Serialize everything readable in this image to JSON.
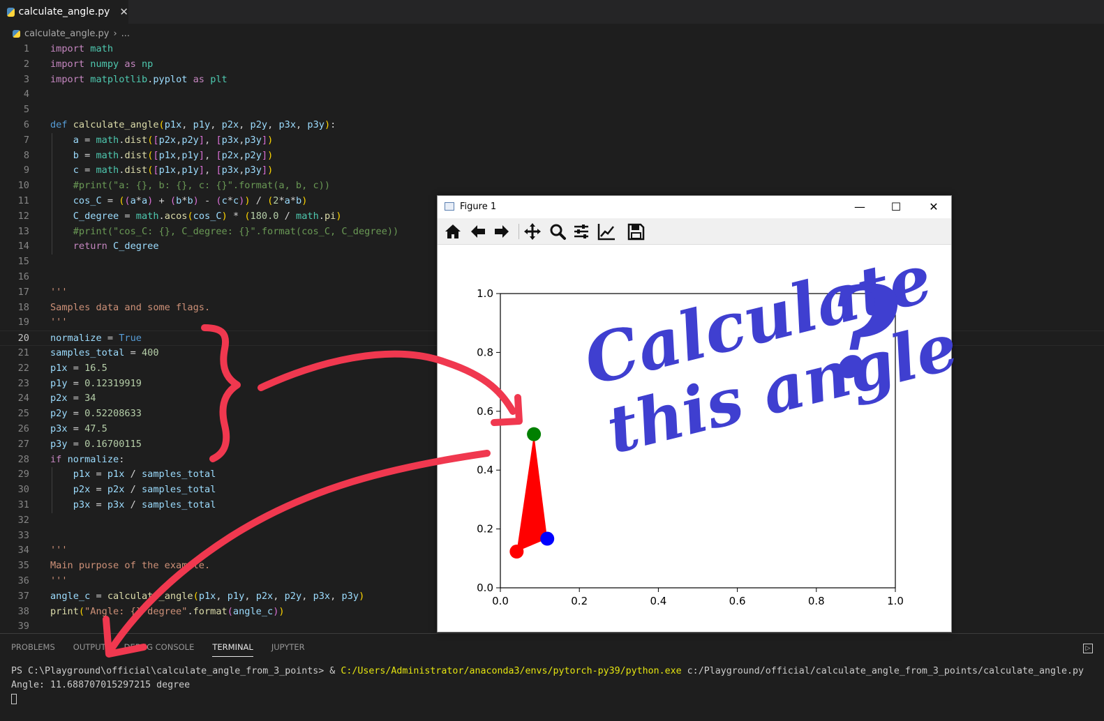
{
  "tab": {
    "filename": "calculate_angle.py",
    "close_glyph": "✕"
  },
  "breadcrumb": {
    "file": "calculate_angle.py",
    "rest": "..."
  },
  "editor": {
    "current_line": 20,
    "lines": [
      "import math",
      "import numpy as np",
      "import matplotlib.pyplot as plt",
      "",
      "",
      "def calculate_angle(p1x, p1y, p2x, p2y, p3x, p3y):",
      "    a = math.dist([p2x,p2y], [p3x,p3y])",
      "    b = math.dist([p1x,p1y], [p2x,p2y])",
      "    c = math.dist([p1x,p1y], [p3x,p3y])",
      "    #print(\"a: {}, b: {}, c: {}\".format(a, b, c))",
      "    cos_C = ((a*a) + (b*b) - (c*c)) / (2*a*b)",
      "    C_degree = math.acos(cos_C) * (180.0 / math.pi)",
      "    #print(\"cos_C: {}, C_degree: {}\".format(cos_C, C_degree))",
      "    return C_degree",
      "",
      "",
      "'''",
      "Samples data and some flags.",
      "'''",
      "normalize = True",
      "samples_total = 400",
      "p1x = 16.5",
      "p1y = 0.12319919",
      "p2x = 34",
      "p2y = 0.52208633",
      "p3x = 47.5",
      "p3y = 0.16700115",
      "if normalize:",
      "    p1x = p1x / samples_total",
      "    p2x = p2x / samples_total",
      "    p3x = p3x / samples_total",
      "",
      "",
      "'''",
      "Main purpose of the example.",
      "'''",
      "angle_c = calculate_angle(p1x, p1y, p2x, p2y, p3x, p3y)",
      "print(\"Angle: {} degree\".format(angle_c))",
      ""
    ]
  },
  "panel": {
    "tabs": [
      "PROBLEMS",
      "OUTPUT",
      "DEBUG CONSOLE",
      "TERMINAL",
      "JUPYTER"
    ],
    "active_tab": "TERMINAL",
    "toggle_glyph": "▷",
    "terminal": {
      "prompt": "PS C:\\Playground\\official\\calculate_angle_from_3_points> & ",
      "exe": "C:/Users/Administrator/anaconda3/envs/pytorch-py39/python.exe",
      "script": " c:/Playground/official/calculate_angle_from_3_points/calculate_angle.py",
      "output": "Angle: 11.688707015297215 degree"
    }
  },
  "figure": {
    "title": "Figure 1",
    "window_buttons": {
      "minimize": "—",
      "maximize": "☐",
      "close": "✕"
    },
    "toolbar": [
      "home-icon",
      "back-icon",
      "forward-icon",
      "pan-icon",
      "zoom-icon",
      "configure-subplots-icon",
      "edit-axis-icon",
      "save-icon"
    ]
  },
  "chart_data": {
    "type": "scatter",
    "xlim": [
      0.0,
      1.0
    ],
    "ylim": [
      0.0,
      1.0
    ],
    "xticks": [
      "0.0",
      "0.2",
      "0.4",
      "0.6",
      "0.8",
      "1.0"
    ],
    "yticks": [
      "0.0",
      "0.2",
      "0.4",
      "0.6",
      "0.8",
      "1.0"
    ],
    "triangle": {
      "x": [
        0.04125,
        0.085,
        0.11875
      ],
      "y": [
        0.12319919,
        0.52208633,
        0.16700115
      ],
      "fill": "#ff0000"
    },
    "points": [
      {
        "x": 0.04125,
        "y": 0.12319919,
        "color": "#ff0000"
      },
      {
        "x": 0.085,
        "y": 0.52208633,
        "color": "#008000"
      },
      {
        "x": 0.11875,
        "y": 0.16700115,
        "color": "#0000ff"
      }
    ],
    "grid": false
  },
  "annotation": {
    "handwriting": [
      "Calculate",
      "this angle",
      "?"
    ],
    "ink_blue": "#3f3fd0",
    "ink_red": "#f0384f"
  }
}
